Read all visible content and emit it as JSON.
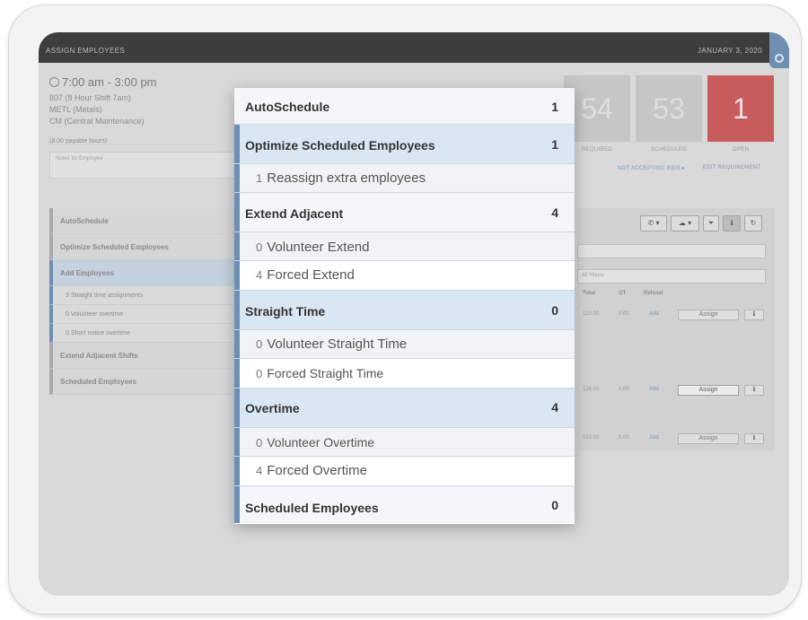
{
  "header": {
    "title": "ASSIGN EMPLOYEES",
    "date": "JANUARY 3, 2020"
  },
  "shift": {
    "time": "7:00 am - 3:00 pm",
    "lines": [
      "807 (8 Hour Shift 7am)",
      "METL (Metals)",
      "CM (Central Maintenance)"
    ],
    "payable": "(8.00 payable hours)",
    "notes_placeholder": "Notes for Employee"
  },
  "stats": [
    {
      "value": "54",
      "label": "REQUIRED"
    },
    {
      "value": "53",
      "label": "SCHEDULED"
    },
    {
      "value": "1",
      "label": "OPEN"
    }
  ],
  "links": {
    "not_accepting": "NOT ACCEPTING BIDS ▸",
    "edit": "EDIT REQUIREMENT"
  },
  "left_list": [
    {
      "label": "AutoSchedule"
    },
    {
      "label": "Optimize Scheduled Employees"
    },
    {
      "label": "Add Employees"
    },
    {
      "label": "3 Straight time assignments"
    },
    {
      "label": "0 Volunteer overtime"
    },
    {
      "label": "0 Short notice overtime"
    },
    {
      "label": "Extend Adjacent Shifts"
    },
    {
      "label": "Scheduled Employees"
    }
  ],
  "right_panel": {
    "filter_select": "All Hours",
    "columns": [
      "Total",
      "OT",
      "Refusal"
    ],
    "rows": [
      {
        "total": "120.00",
        "ot": "0.00",
        "refusal": "Add",
        "action": "Assign"
      },
      {
        "total": "136.00",
        "ot": "0.00",
        "refusal": "Add",
        "action": "Assign"
      },
      {
        "total": "152.00",
        "ot": "0.00",
        "refusal": "Add",
        "action": "Assign"
      }
    ]
  },
  "popup": {
    "autoschedule": {
      "label": "AutoSchedule",
      "count": "1"
    },
    "optimize": {
      "label": "Optimize Scheduled Employees",
      "count": "1"
    },
    "reassign": {
      "n": "1",
      "label": "Reassign extra employees"
    },
    "extend": {
      "label": "Extend Adjacent",
      "count": "4"
    },
    "vol_extend": {
      "n": "0",
      "label": "Volunteer Extend"
    },
    "forced_extend": {
      "n": "4",
      "label": "Forced Extend"
    },
    "straight": {
      "label": "Straight Time",
      "count": "0"
    },
    "vol_straight": {
      "n": "0",
      "label": "Volunteer Straight Time"
    },
    "forced_straight": {
      "n": "0",
      "label": "Forced Straight Time"
    },
    "overtime": {
      "label": "Overtime",
      "count": "4"
    },
    "vol_overtime": {
      "n": "0",
      "label": "Volunteer Overtime"
    },
    "forced_overtime": {
      "n": "4",
      "label": "Forced Overtime"
    },
    "scheduled": {
      "label": "Scheduled Employees",
      "count": "0"
    }
  },
  "colors": {
    "accent": "#6b8fb5",
    "open_red": "#c85c5c",
    "section_blue": "#d9e7f3"
  }
}
